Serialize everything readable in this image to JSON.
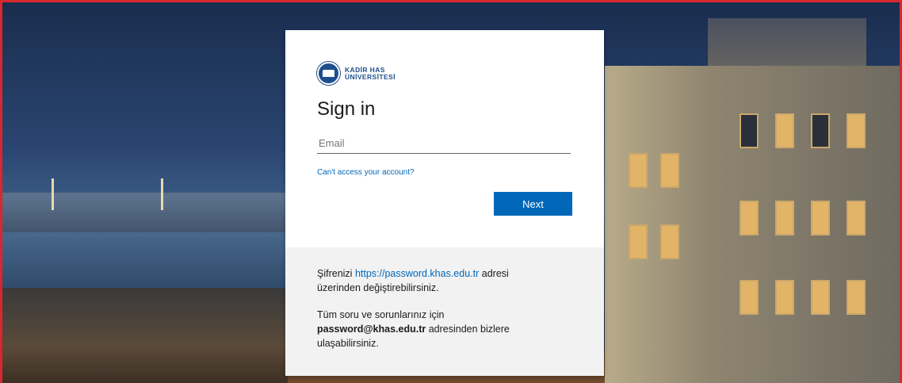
{
  "logo": {
    "line1": "KADİR HAS",
    "line2": "ÜNİVERSİTESİ"
  },
  "signin": {
    "title": "Sign in",
    "email_placeholder": "Email",
    "email_value": "",
    "cant_access_link": "Can't access your account?",
    "next_button": "Next"
  },
  "info": {
    "p1_prefix": "Şifrenizi ",
    "p1_link": "https://password.khas.edu.tr",
    "p1_suffix": " adresi üzerinden değiştirebilirsiniz.",
    "p2_prefix": "Tüm soru ve sorunlarınız için ",
    "p2_bold": "password@khas.edu.tr",
    "p2_suffix": " adresinden bizlere ulaşabilirsiniz."
  },
  "colors": {
    "accent": "#0067b8",
    "frame": "#d7282f",
    "brand": "#1f4e8c"
  }
}
